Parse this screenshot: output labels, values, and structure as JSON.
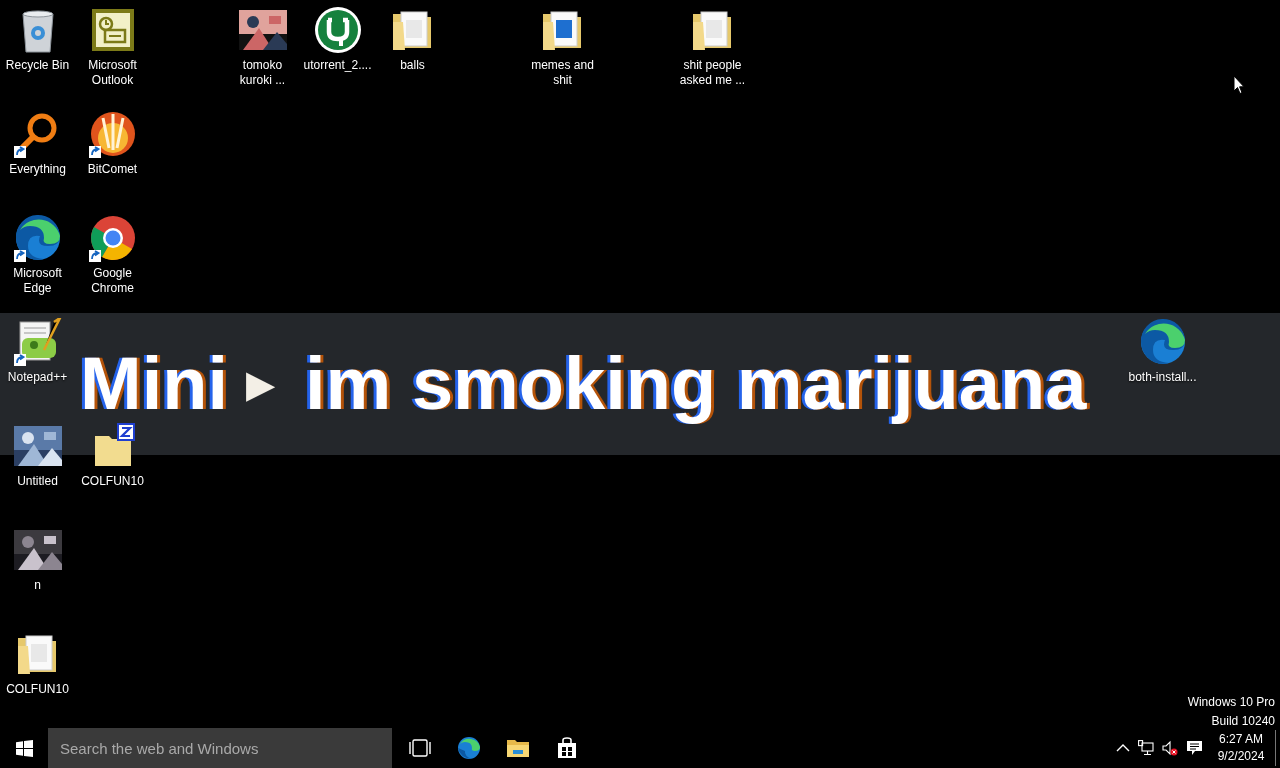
{
  "desktop": {
    "icons": [
      {
        "label": "Recycle Bin",
        "kind": "recycle-bin",
        "shortcut": false
      },
      {
        "label": "Microsoft Outlook",
        "kind": "outlook",
        "shortcut": false
      },
      {
        "label": "tomoko kuroki ...",
        "kind": "picture",
        "shortcut": false
      },
      {
        "label": "utorrent_2....",
        "kind": "utorrent",
        "shortcut": false
      },
      {
        "label": "balls",
        "kind": "folder",
        "shortcut": false
      },
      {
        "label": "memes and shit",
        "kind": "folder",
        "shortcut": false
      },
      {
        "label": "shit people asked me ...",
        "kind": "folder",
        "shortcut": false
      },
      {
        "label": "Everything",
        "kind": "everything",
        "shortcut": true
      },
      {
        "label": "BitComet",
        "kind": "bitcomet",
        "shortcut": true
      },
      {
        "label": "Microsoft Edge",
        "kind": "edge",
        "shortcut": true
      },
      {
        "label": "Google Chrome",
        "kind": "chrome",
        "shortcut": true
      },
      {
        "label": "Notepad++",
        "kind": "notepad",
        "shortcut": true
      },
      {
        "label": "both-install...",
        "kind": "edge",
        "shortcut": false
      },
      {
        "label": "Untitled",
        "kind": "picture",
        "shortcut": false
      },
      {
        "label": "COLFUN10",
        "kind": "zip-folder",
        "shortcut": false
      },
      {
        "label": "n",
        "kind": "picture",
        "shortcut": false
      },
      {
        "label": "COLFUN10",
        "kind": "folder",
        "shortcut": false
      }
    ]
  },
  "overlay": {
    "title": "Mini",
    "separator": "▶",
    "caption": "im smoking marijuana"
  },
  "edition": {
    "name": "Windows 10 Pro",
    "build": "Build 10240"
  },
  "taskbar": {
    "search": {
      "placeholder": "Search the web and Windows"
    },
    "pinned": [
      {
        "kind": "task-view"
      },
      {
        "kind": "edge"
      },
      {
        "kind": "file-explorer"
      },
      {
        "kind": "store"
      }
    ],
    "tray": {
      "volume_muted": true,
      "time": "6:27 AM",
      "date": "9/2/2024"
    }
  }
}
